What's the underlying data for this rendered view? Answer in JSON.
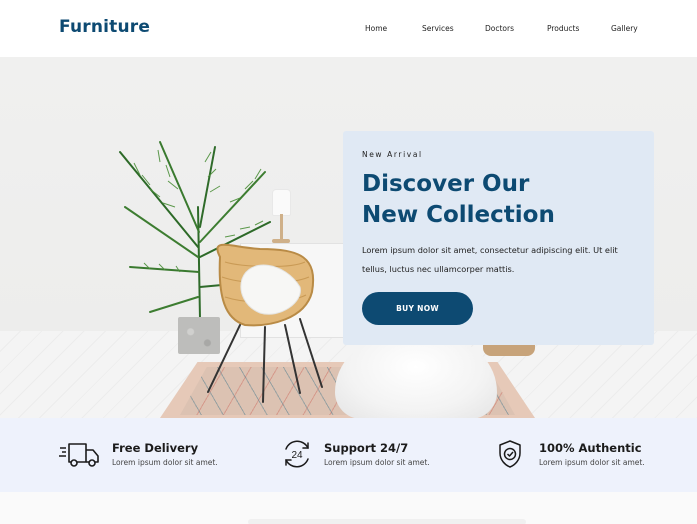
{
  "header": {
    "logo": "Furniture",
    "nav": [
      "Home",
      "Services",
      "Doctors",
      "Products",
      "Gallery"
    ]
  },
  "hero": {
    "eyebrow": "New Arrival",
    "headline_line1": "Discover Our",
    "headline_line2": "New Collection",
    "description": "Lorem ipsum dolor sit amet, consectetur adipiscing elit. Ut elit tellus, luctus nec ullamcorper mattis.",
    "cta_label": "BUY NOW"
  },
  "features": [
    {
      "title": "Free Delivery",
      "text": "Lorem ipsum dolor sit amet.",
      "icon": "truck-icon"
    },
    {
      "title": "Support 24/7",
      "text": "Lorem ipsum dolor sit amet.",
      "icon": "support-24-icon"
    },
    {
      "title": "100% Authentic",
      "text": "Lorem ipsum dolor sit amet.",
      "icon": "shield-check-icon"
    }
  ],
  "colors": {
    "brand": "#0d4a72",
    "card_bg": "#e0e9f4",
    "features_bg": "#eef2fc"
  }
}
